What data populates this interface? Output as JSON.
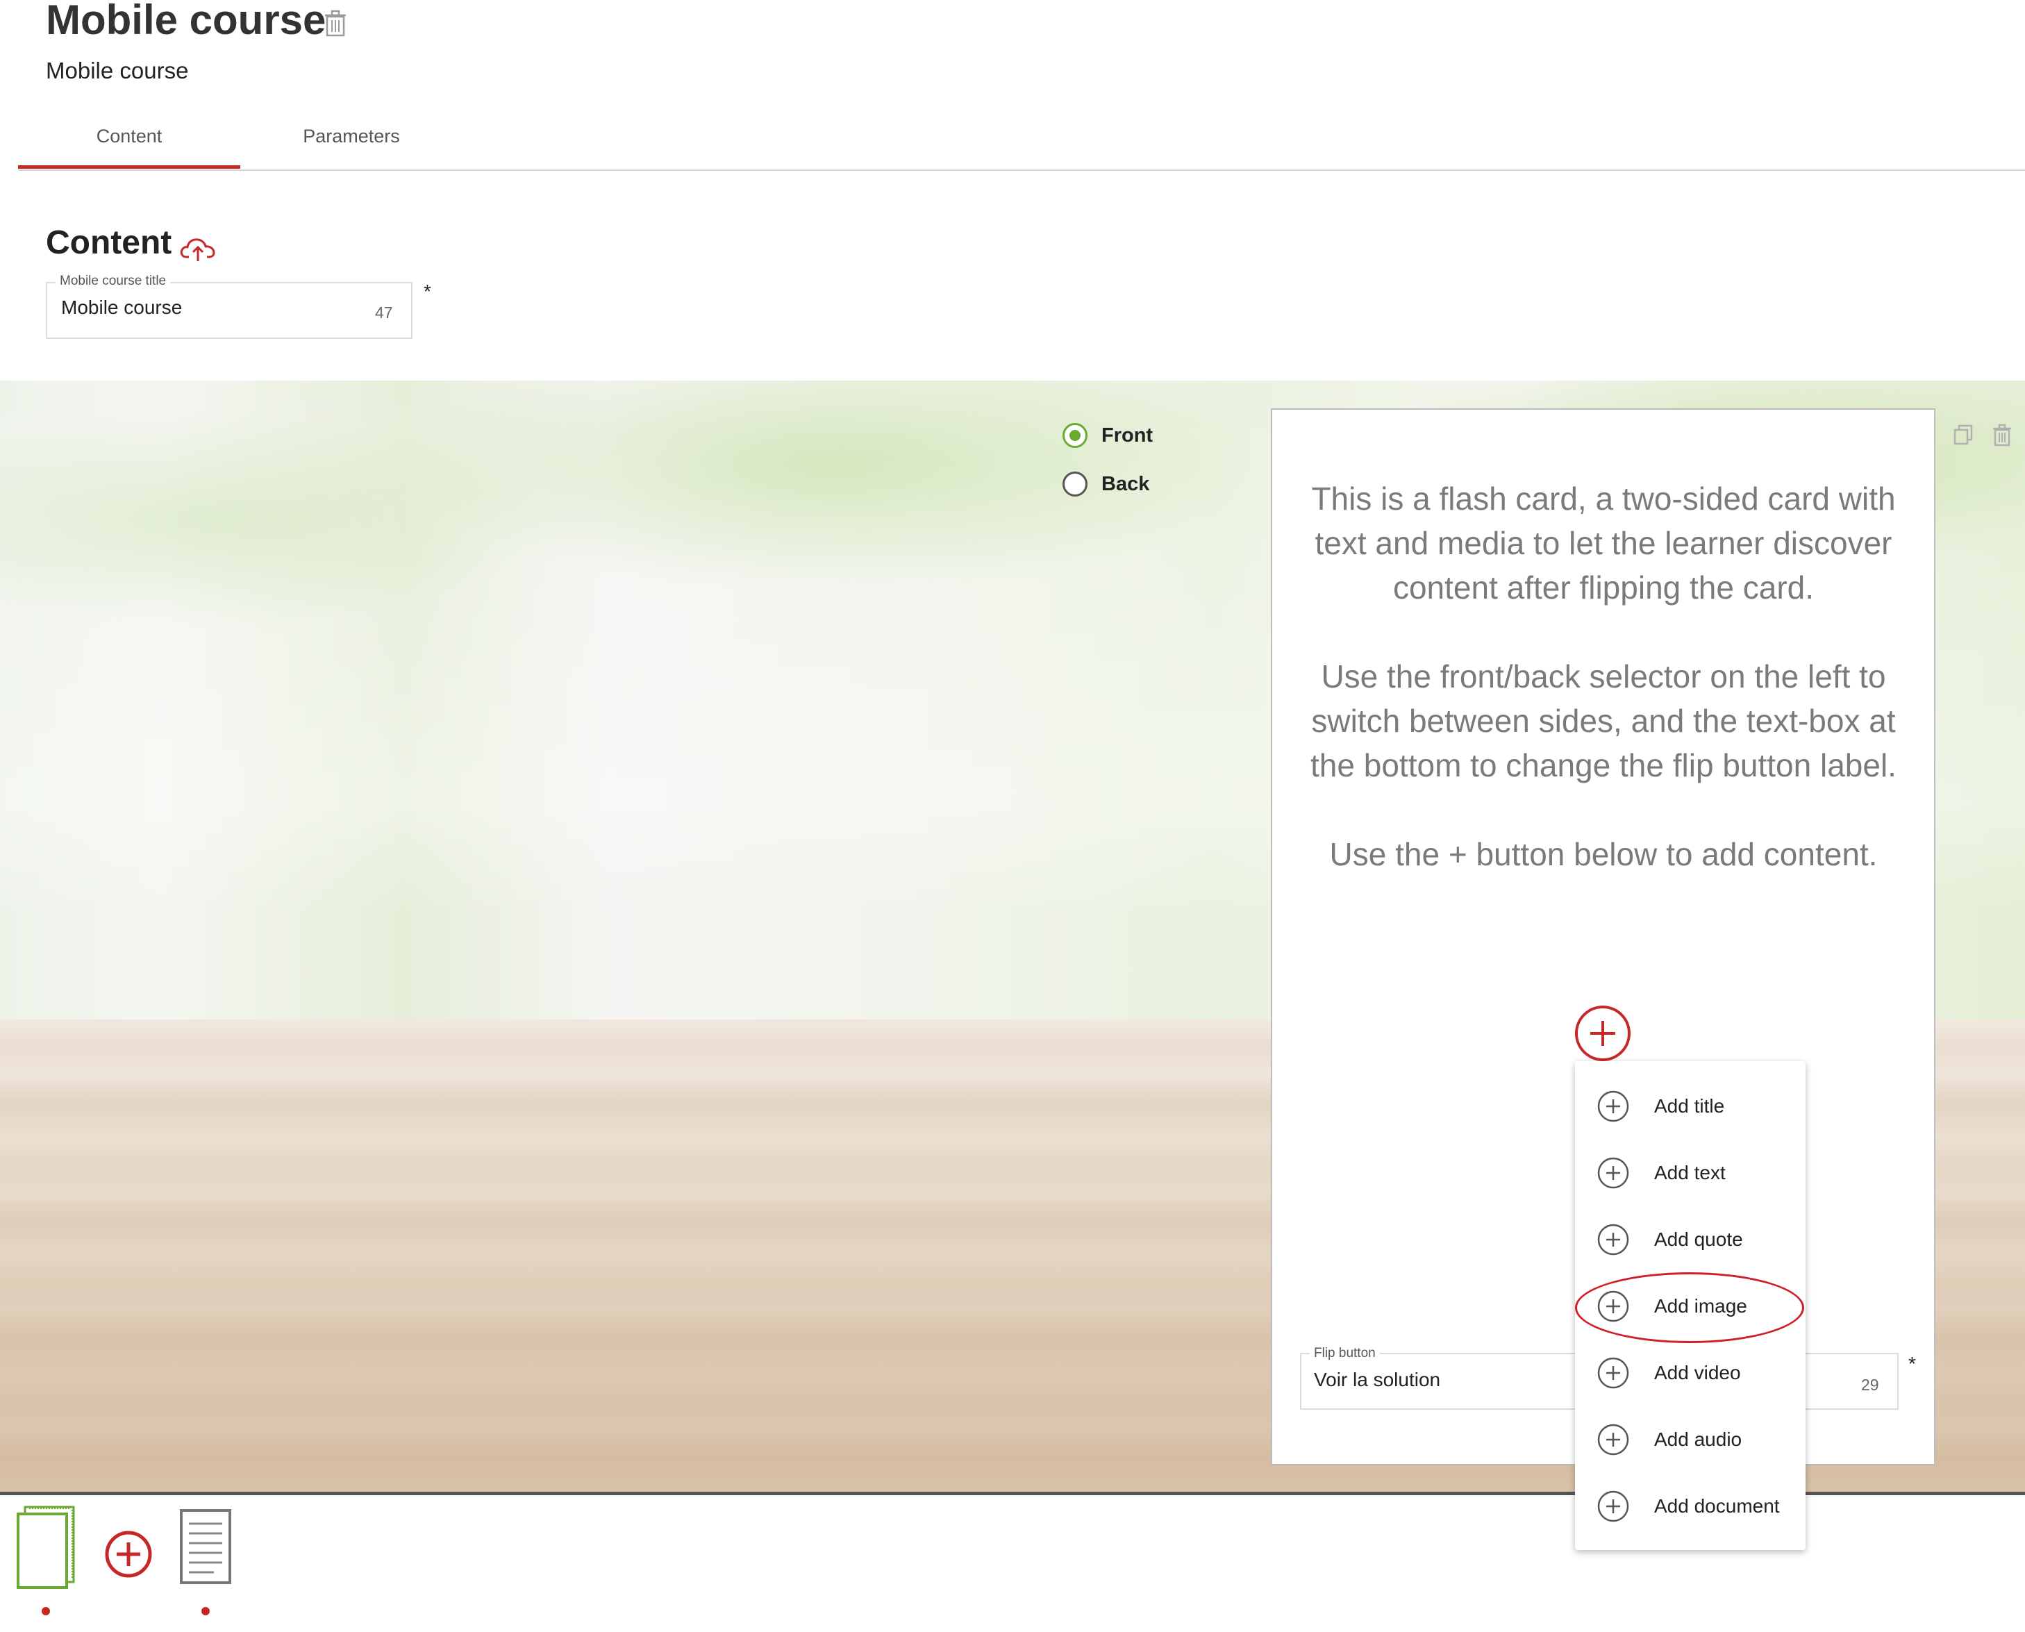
{
  "header": {
    "title": "Mobile course",
    "subtitle": "Mobile course"
  },
  "tabs": [
    {
      "label": "Content",
      "active": true
    },
    {
      "label": "Parameters",
      "active": false
    }
  ],
  "content_section": {
    "title": "Content",
    "course_title_field": {
      "label": "Mobile course title",
      "value": "Mobile course",
      "remaining_chars": "47",
      "required_marker": "*"
    }
  },
  "side_selector": {
    "options": [
      {
        "label": "Front",
        "selected": true
      },
      {
        "label": "Back",
        "selected": false
      }
    ]
  },
  "card": {
    "paragraphs": [
      "This is a flash card, a two-sided card with text and media to let the learner discover content after flipping the card.",
      "Use the front/back selector on the left to switch between sides, and the text-box at the bottom to change the flip button label.",
      "Use the + button below to add content."
    ],
    "flip_button_field": {
      "label": "Flip button",
      "value": "Voir la solution",
      "remaining_chars": "29",
      "required_marker": "*"
    }
  },
  "add_menu": {
    "items": [
      {
        "label": "Add title"
      },
      {
        "label": "Add text"
      },
      {
        "label": "Add quote"
      },
      {
        "label": "Add image",
        "highlighted": true
      },
      {
        "label": "Add video"
      },
      {
        "label": "Add audio"
      },
      {
        "label": "Add document"
      }
    ]
  },
  "icons": {
    "trash": "trash-icon",
    "upload": "cloud-upload-icon",
    "duplicate": "duplicate-icon",
    "add": "plus-circle-icon",
    "flashcard": "flashcard-icon",
    "document": "document-icon"
  },
  "colors": {
    "accent_red": "#c62828",
    "selected_green": "#6aaa32",
    "card_text": "#7a7a7a",
    "highlight_oval": "#d01f2a"
  }
}
